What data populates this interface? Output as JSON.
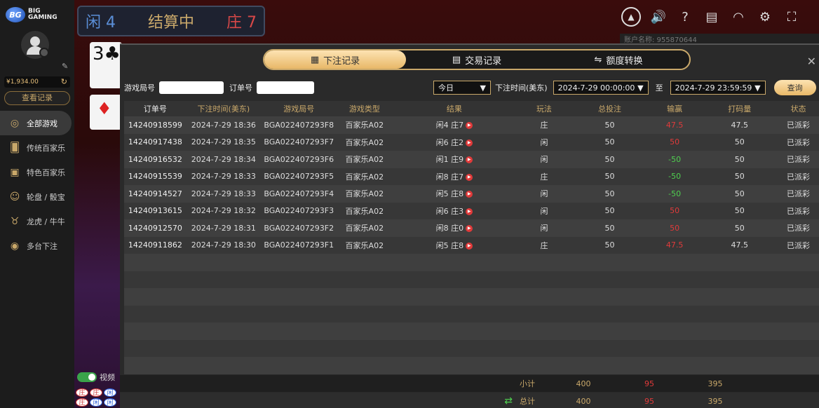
{
  "brand": {
    "badge": "BG",
    "line1": "BIG",
    "line2": "GAMING"
  },
  "user": {
    "balance": "¥1,934.00",
    "records_label": "查看记录"
  },
  "nav": [
    {
      "label": "全部游戏",
      "icon": "roulette-icon"
    },
    {
      "label": "传统百家乐",
      "icon": "cards-icon"
    },
    {
      "label": "特色百家乐",
      "icon": "card-icon"
    },
    {
      "label": "轮盘 / 骰宝",
      "icon": "dealer-icon"
    },
    {
      "label": "龙虎 / 牛牛",
      "icon": "bull-icon"
    },
    {
      "label": "多台下注",
      "icon": "chips-icon"
    }
  ],
  "game": {
    "player": "闲 4",
    "status": "结算中",
    "banker": "庄 7",
    "card1": "3♣",
    "card2": "♦"
  },
  "account_strip": "账户名称: 955870644",
  "video_toggle": "视频",
  "road": [
    "庄",
    "庄",
    "闲",
    "庄",
    "闲",
    "闲"
  ],
  "tabs": [
    {
      "label": "下注记录",
      "icon": "calendar-icon"
    },
    {
      "label": "交易记录",
      "icon": "document-icon"
    },
    {
      "label": "额度转换",
      "icon": "transfer-icon"
    }
  ],
  "filter": {
    "round_label": "游戏局号",
    "order_label": "订单号",
    "period": "今日",
    "time_label": "下注时间(美东)",
    "start": "2024-7-29 00:00:00",
    "to": "至",
    "end": "2024-7-29 23:59:59",
    "query": "查询"
  },
  "columns": [
    "订单号",
    "下注时间(美东)",
    "游戏局号",
    "游戏类型",
    "结果",
    "玩法",
    "总投注",
    "输赢",
    "打码量",
    "状态"
  ],
  "rows": [
    {
      "order": "14240918599",
      "time": "2024-7-29 18:36",
      "round": "BGA022407293F8",
      "type": "百家乐A02",
      "result": "闲4 庄7",
      "play": "庄",
      "bet": "50",
      "win": "47.5",
      "win_color": "red",
      "turnover": "47.5",
      "status": "已派彩"
    },
    {
      "order": "14240917438",
      "time": "2024-7-29 18:35",
      "round": "BGA022407293F7",
      "type": "百家乐A02",
      "result": "闲6 庄2",
      "play": "闲",
      "bet": "50",
      "win": "50",
      "win_color": "red",
      "turnover": "50",
      "status": "已派彩"
    },
    {
      "order": "14240916532",
      "time": "2024-7-29 18:34",
      "round": "BGA022407293F6",
      "type": "百家乐A02",
      "result": "闲1 庄9",
      "play": "闲",
      "bet": "50",
      "win": "-50",
      "win_color": "green",
      "turnover": "50",
      "status": "已派彩"
    },
    {
      "order": "14240915539",
      "time": "2024-7-29 18:33",
      "round": "BGA022407293F5",
      "type": "百家乐A02",
      "result": "闲8 庄7",
      "play": "庄",
      "bet": "50",
      "win": "-50",
      "win_color": "green",
      "turnover": "50",
      "status": "已派彩"
    },
    {
      "order": "14240914527",
      "time": "2024-7-29 18:33",
      "round": "BGA022407293F4",
      "type": "百家乐A02",
      "result": "闲5 庄8",
      "play": "闲",
      "bet": "50",
      "win": "-50",
      "win_color": "green",
      "turnover": "50",
      "status": "已派彩"
    },
    {
      "order": "14240913615",
      "time": "2024-7-29 18:32",
      "round": "BGA022407293F3",
      "type": "百家乐A02",
      "result": "闲6 庄3",
      "play": "闲",
      "bet": "50",
      "win": "50",
      "win_color": "red",
      "turnover": "50",
      "status": "已派彩"
    },
    {
      "order": "14240912570",
      "time": "2024-7-29 18:31",
      "round": "BGA022407293F2",
      "type": "百家乐A02",
      "result": "闲8 庄0",
      "play": "闲",
      "bet": "50",
      "win": "50",
      "win_color": "red",
      "turnover": "50",
      "status": "已派彩"
    },
    {
      "order": "14240911862",
      "time": "2024-7-29 18:30",
      "round": "BGA022407293F1",
      "type": "百家乐A02",
      "result": "闲5 庄8",
      "play": "庄",
      "bet": "50",
      "win": "47.5",
      "win_color": "red",
      "turnover": "47.5",
      "status": "已派彩"
    }
  ],
  "subtotal": {
    "label": "小计",
    "bet": "400",
    "win": "95",
    "turnover": "395"
  },
  "total": {
    "label": "总计",
    "bet": "400",
    "win": "95",
    "turnover": "395"
  }
}
